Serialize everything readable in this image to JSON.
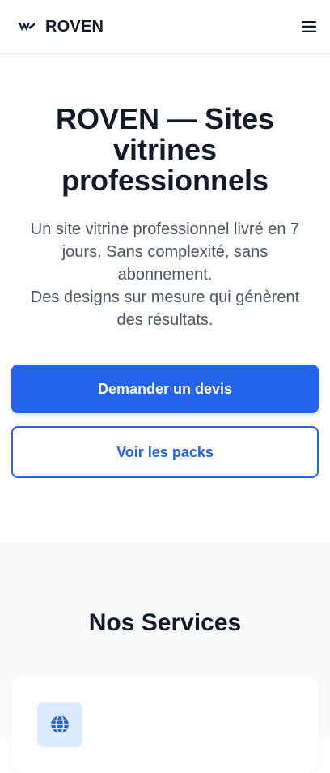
{
  "header": {
    "brand_name": "ROVEN",
    "logo_icon": "roven-logo-icon",
    "menu_icon": "hamburger-menu-icon"
  },
  "hero": {
    "title": "ROVEN — Sites vitrines professionnels",
    "subtitle_line1": "Un site vitrine professionnel livré en 7 jours. Sans complexité, sans abonnement.",
    "subtitle_line2": "Des designs sur mesure qui génèrent des résultats.",
    "cta_primary": "Demander un devis",
    "cta_secondary": "Voir les packs"
  },
  "services": {
    "title": "Nos Services",
    "cards": [
      {
        "icon": "globe-icon"
      }
    ]
  },
  "colors": {
    "accent": "#2563eb",
    "text_dark": "#111827",
    "text_muted": "#4b5563",
    "section_bg": "#f9fafb",
    "icon_bg": "#dbeafe"
  }
}
